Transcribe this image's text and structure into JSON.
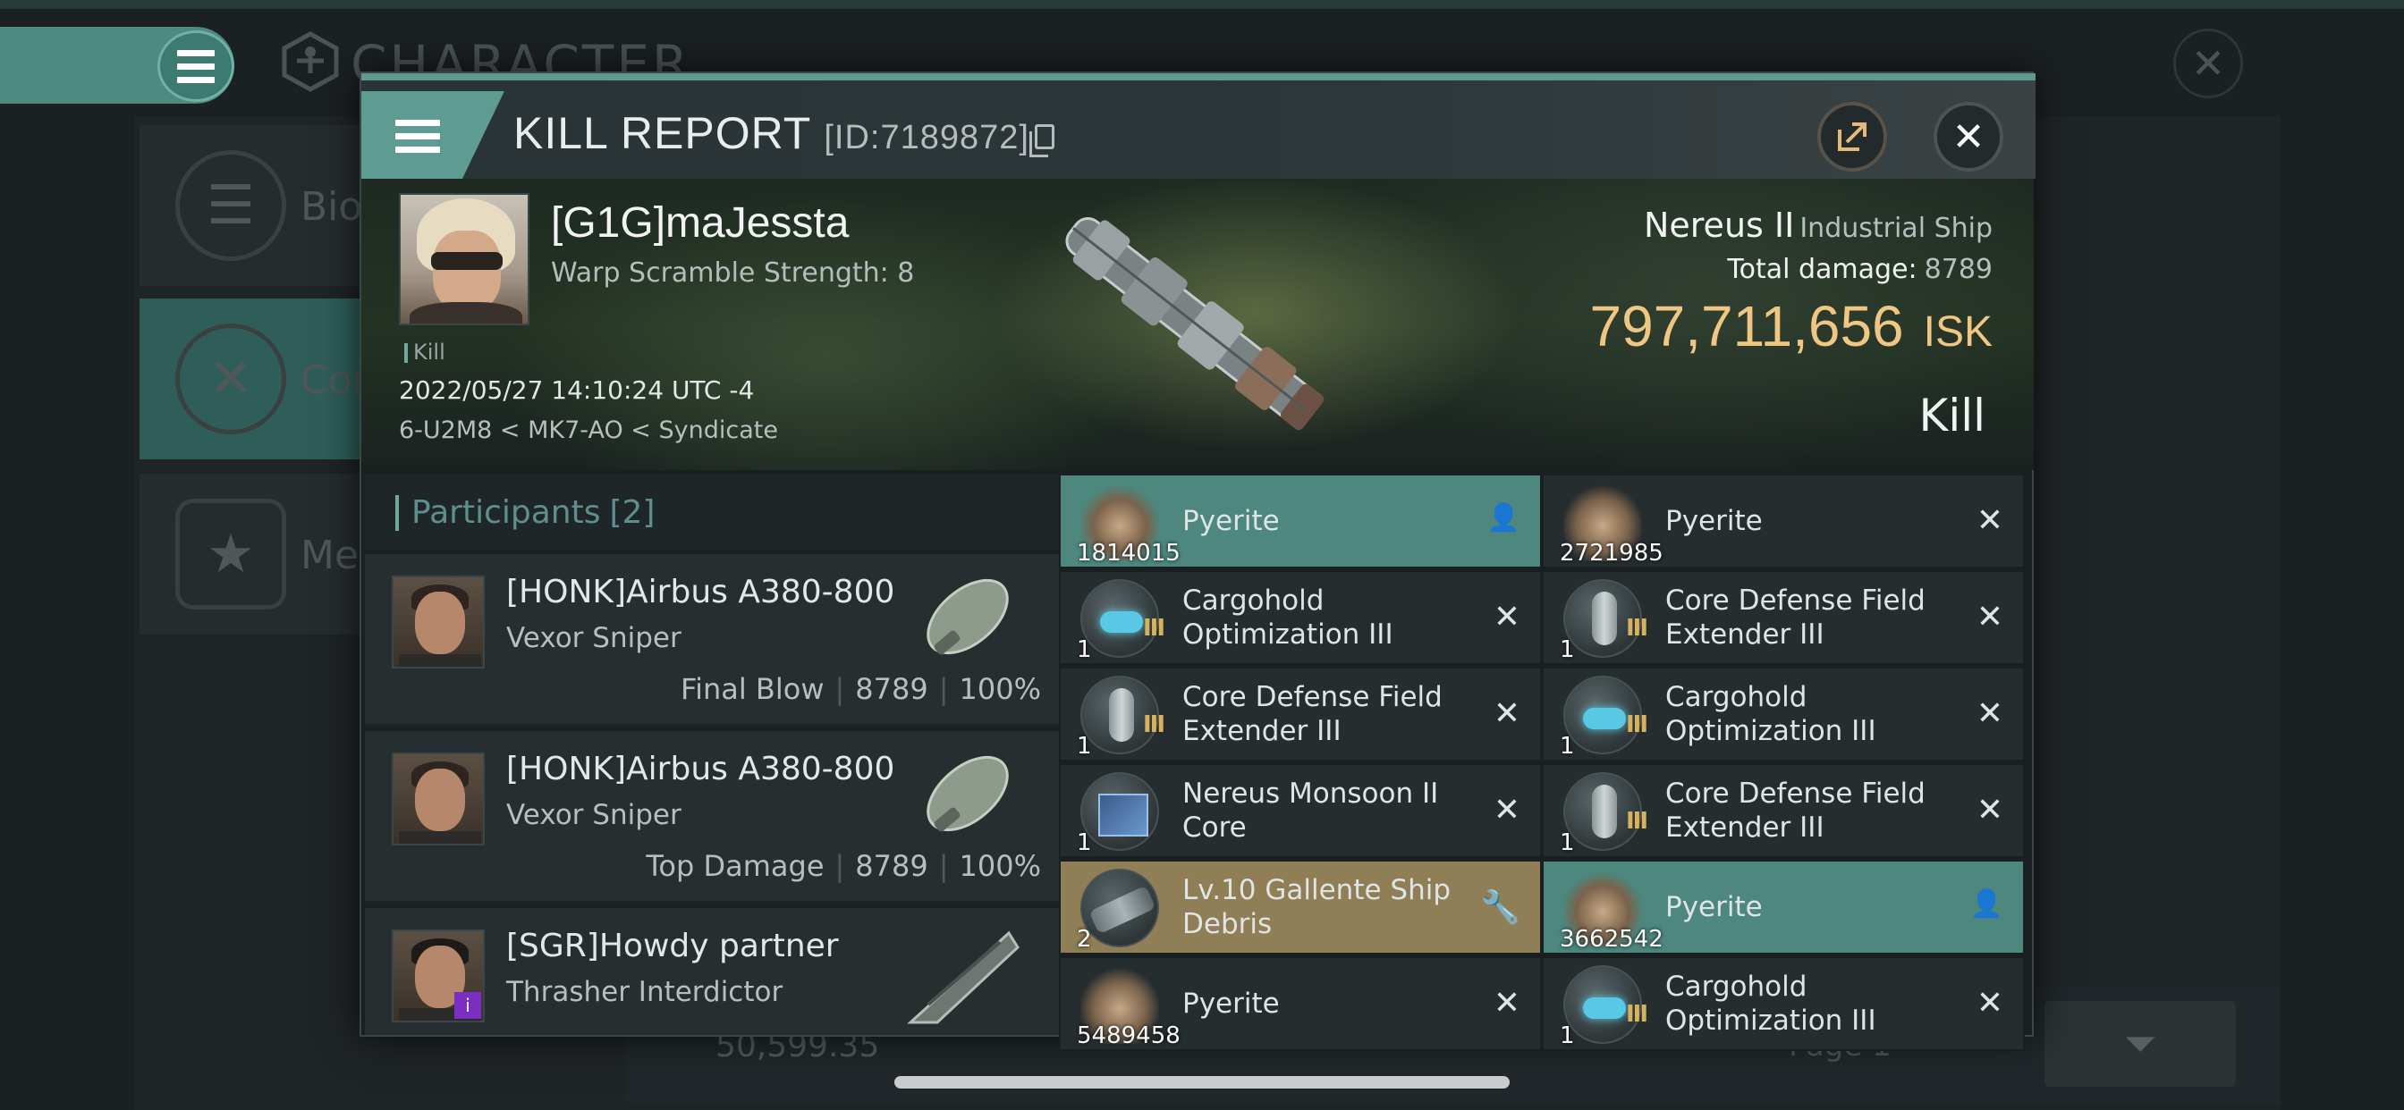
{
  "background": {
    "title": "CHARACTER",
    "sidebar_items": [
      "Bio",
      "Cor",
      "Me"
    ],
    "bottom_value": "50,599.35",
    "bottom_page": "Page 1"
  },
  "dialog": {
    "title": "KILL REPORT",
    "id_label": "[ID:7189872]"
  },
  "victim": {
    "name": "[G1G]maJessta",
    "warp_scramble": "Warp Scramble Strength: 8",
    "kill_tag": "Kill",
    "timestamp": "2022/05/27 14:10:24 UTC -4",
    "location": "6-U2M8 < MK7-AO < Syndicate",
    "ship_name": "Nereus II",
    "ship_class": "Industrial Ship",
    "total_damage_label": "Total damage:",
    "total_damage": "8789",
    "isk_value": "797,711,656",
    "isk_unit": "ISK",
    "result": "Kill"
  },
  "participants": {
    "label": "Participants",
    "count": "[2]",
    "rows": [
      {
        "name": "[HONK]Airbus A380-800",
        "ship": "Vexor Sniper",
        "role": "Final Blow",
        "damage": "8789",
        "percent": "100%"
      },
      {
        "name": "[HONK]Airbus A380-800",
        "ship": "Vexor Sniper",
        "role": "Top Damage",
        "damage": "8789",
        "percent": "100%"
      },
      {
        "name": "[SGR]Howdy partner",
        "ship": "Thrasher Interdictor",
        "role": "",
        "damage": "",
        "percent": ""
      }
    ]
  },
  "items_left": [
    {
      "name": "Pyerite",
      "qty": "1814015",
      "icon": "ore-icon",
      "status": "user-icon"
    },
    {
      "name": "Cargohold Optimization III",
      "qty": "1",
      "icon": "cargohold-icon",
      "status": "close-icon"
    },
    {
      "name": "Core Defense Field Extender III",
      "qty": "1",
      "icon": "core-defense-icon",
      "status": "close-icon"
    },
    {
      "name": "Nereus Monsoon II Core",
      "qty": "1",
      "icon": "monsoon-core-icon",
      "status": "close-icon"
    },
    {
      "name": "Lv.10 Gallente Ship Debris",
      "qty": "2",
      "icon": "ship-debris-icon",
      "status": "wrench-icon"
    },
    {
      "name": "Pyerite",
      "qty": "5489458",
      "icon": "ore-icon",
      "status": "close-icon"
    }
  ],
  "items_right": [
    {
      "name": "Pyerite",
      "qty": "2721985",
      "icon": "ore-icon",
      "status": "close-icon"
    },
    {
      "name": "Core Defense Field Extender III",
      "qty": "1",
      "icon": "core-defense-icon",
      "status": "close-icon"
    },
    {
      "name": "Cargohold Optimization III",
      "qty": "1",
      "icon": "cargohold-icon",
      "status": "close-icon"
    },
    {
      "name": "Core Defense Field Extender III",
      "qty": "1",
      "icon": "core-defense-icon",
      "status": "close-icon"
    },
    {
      "name": "Pyerite",
      "qty": "3662542",
      "icon": "ore-icon",
      "status": "user-icon"
    },
    {
      "name": "Cargohold Optimization III",
      "qty": "1",
      "icon": "cargohold-icon",
      "status": "close-icon"
    }
  ],
  "colors": {
    "accent_teal": "#5e9b91",
    "isk_gold": "#efc783",
    "highlight_gold": "#8f7e56"
  }
}
